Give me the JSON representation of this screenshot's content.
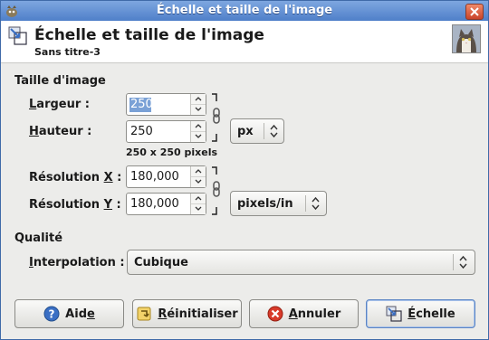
{
  "window": {
    "title": "Échelle et taille de l'image"
  },
  "header": {
    "title": "Échelle et taille de l'image",
    "subtitle": "Sans titre-3"
  },
  "image_size": {
    "section_label": "Taille d'image",
    "width": {
      "label_pre": "",
      "label_ul": "L",
      "label_post": "argeur :",
      "value": "250"
    },
    "height": {
      "label_pre": "",
      "label_ul": "H",
      "label_post": "auteur :",
      "value": "250"
    },
    "pixel_summary": "250 x 250 pixels",
    "unit": "px",
    "res_x": {
      "label_pre": "Résolution ",
      "label_ul": "X",
      "label_post": " :",
      "value": "180,000"
    },
    "res_y": {
      "label_pre": "Résolution ",
      "label_ul": "Y",
      "label_post": " :",
      "value": "180,000"
    },
    "res_unit": "pixels/in"
  },
  "quality": {
    "section_label": "Qualité",
    "interpolation": {
      "label_pre": "",
      "label_ul": "I",
      "label_post": "nterpolation :",
      "value": "Cubique"
    }
  },
  "buttons": {
    "help": {
      "pre": "Aid",
      "ul": "e",
      "post": ""
    },
    "reset": {
      "pre": "",
      "ul": "R",
      "post": "éinitialiser"
    },
    "cancel": {
      "pre": "",
      "ul": "A",
      "post": "nnuler"
    },
    "scale": {
      "pre": "",
      "ul": "É",
      "post": "chelle"
    }
  },
  "colors": {
    "titlebar": "#5b8bd0",
    "selection": "#7aa1d6",
    "help_icon": "#3a6fc4",
    "cancel_icon": "#d83a2a"
  }
}
